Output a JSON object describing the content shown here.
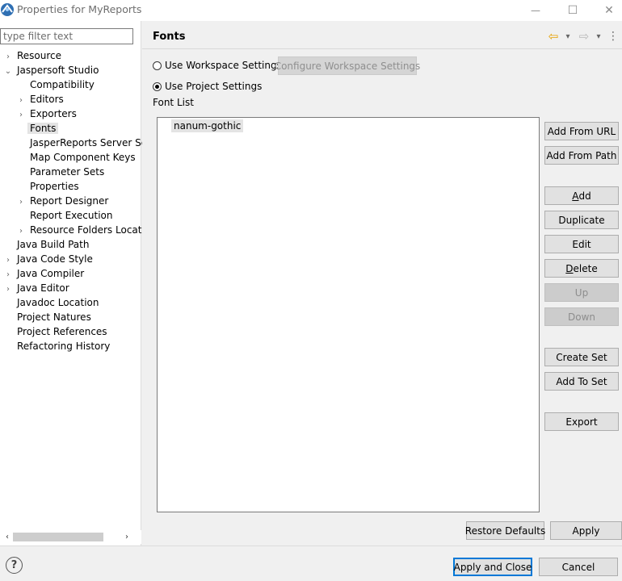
{
  "window": {
    "title": "Properties for MyReports",
    "controls": {
      "minimize": "—",
      "maximize": "☐",
      "close": "✕"
    }
  },
  "filter": {
    "placeholder": "type filter text",
    "value": ""
  },
  "tree": [
    {
      "label": "Resource",
      "expander": "›",
      "level": 0
    },
    {
      "label": "Jaspersoft Studio",
      "expander": "⌄",
      "level": 0
    },
    {
      "label": "Compatibility",
      "expander": "",
      "level": 1
    },
    {
      "label": "Editors",
      "expander": "›",
      "level": 1
    },
    {
      "label": "Exporters",
      "expander": "›",
      "level": 1
    },
    {
      "label": "Fonts",
      "expander": "",
      "level": 1,
      "selected": true
    },
    {
      "label": "JasperReports Server Set",
      "expander": "",
      "level": 1
    },
    {
      "label": "Map Component Keys",
      "expander": "",
      "level": 1
    },
    {
      "label": "Parameter Sets",
      "expander": "",
      "level": 1
    },
    {
      "label": "Properties",
      "expander": "",
      "level": 1
    },
    {
      "label": "Report Designer",
      "expander": "›",
      "level": 1
    },
    {
      "label": "Report Execution",
      "expander": "",
      "level": 1
    },
    {
      "label": "Resource Folders Locatic",
      "expander": "›",
      "level": 1
    },
    {
      "label": "Java Build Path",
      "expander": "",
      "level": 0
    },
    {
      "label": "Java Code Style",
      "expander": "›",
      "level": 0
    },
    {
      "label": "Java Compiler",
      "expander": "›",
      "level": 0
    },
    {
      "label": "Java Editor",
      "expander": "›",
      "level": 0
    },
    {
      "label": "Javadoc Location",
      "expander": "",
      "level": 0
    },
    {
      "label": "Project Natures",
      "expander": "",
      "level": 0
    },
    {
      "label": "Project References",
      "expander": "",
      "level": 0
    },
    {
      "label": "Refactoring History",
      "expander": "",
      "level": 0
    }
  ],
  "scrollbar": {
    "left": "‹",
    "right": "›"
  },
  "page": {
    "title": "Fonts",
    "nav": {
      "back": "⇦",
      "back_menu": "▾",
      "forward": "⇨",
      "forward_menu": "▾",
      "more": "⋮"
    },
    "use_workspace_label": "Use Workspace Settings",
    "configure_workspace_label": "Configure Workspace Settings",
    "use_project_label": "Use Project Settings",
    "font_list_label": "Font List",
    "fonts": [
      "nanum-gothic"
    ],
    "buttons": {
      "add_from_url": "Add From URL",
      "add_from_path": "Add From Path",
      "add_mnemonic": "A",
      "add_rest": "dd",
      "duplicate": "Duplicate",
      "edit": "Edit",
      "delete_mnemonic": "D",
      "delete_rest": "elete",
      "up": "Up",
      "down": "Down",
      "create_set": "Create Set",
      "add_to_set": "Add To Set",
      "export": "Export",
      "restore_defaults": "Restore Defaults",
      "apply": "Apply"
    }
  },
  "footer": {
    "help": "?",
    "apply_and_close": "Apply and Close",
    "cancel": "Cancel"
  },
  "colors": {
    "accent": "#0078d7",
    "background": "#f0f0f0",
    "disabled_text": "#8d8d8d"
  }
}
